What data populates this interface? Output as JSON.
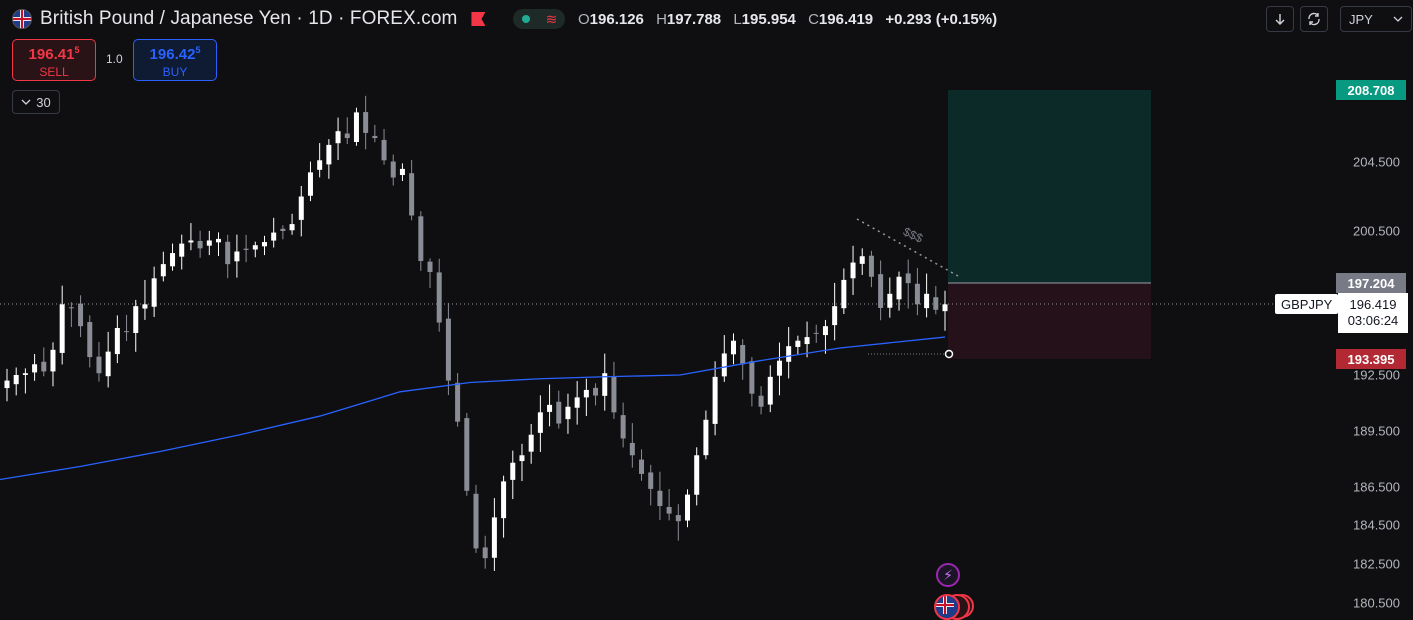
{
  "header": {
    "title": "British Pound / Japanese Yen · 1D · FOREX.com",
    "ohlc": {
      "open_label": "O",
      "open": "196.126",
      "high_label": "H",
      "high": "197.788",
      "low_label": "L",
      "low": "195.954",
      "close_label": "C",
      "close": "196.419",
      "change": "+0.293 (+0.15%)"
    }
  },
  "toolbar": {
    "currency": "JPY",
    "download_icon": "arrow-down-icon",
    "sync_icon": "sync-icon"
  },
  "trade": {
    "sell_price": "196.41",
    "sell_price_sup": "5",
    "sell_label": "SELL",
    "quantity": "1.0",
    "buy_price": "196.42",
    "buy_price_sup": "5",
    "buy_label": "BUY"
  },
  "indicator_toggle": {
    "label": "30"
  },
  "price_axis": {
    "labels": [
      "204.500",
      "200.500",
      "192.500",
      "189.500",
      "186.500",
      "184.500",
      "182.500",
      "180.500"
    ]
  },
  "position_tool": {
    "take_profit": "208.708",
    "entry": "197.204",
    "stop_loss": "193.395"
  },
  "current_price": {
    "symbol": "GBPJPY",
    "price": "196.419",
    "countdown": "03:06:24"
  },
  "annotation": "$$$",
  "colors": {
    "background": "#0f0f11",
    "candle_up": "#ffffff",
    "candle_down": "#8a8d96",
    "ma_line": "#2962ff",
    "tp_zone": "#0c2a27",
    "sl_zone": "#24111a",
    "sell": "#f23645",
    "buy": "#2962ff"
  },
  "chart_data": {
    "type": "candlestick",
    "symbol": "GBPJPY",
    "interval": "1D",
    "source": "FOREX.com",
    "ylim": [
      180.0,
      210.0
    ],
    "y_scale": "log-like (TradingView auto)",
    "ma_approx": [
      [
        0,
        186.9
      ],
      [
        80,
        187.6
      ],
      [
        160,
        188.4
      ],
      [
        240,
        189.3
      ],
      [
        320,
        190.3
      ],
      [
        400,
        191.6
      ],
      [
        470,
        192.1
      ],
      [
        540,
        192.3
      ],
      [
        600,
        192.4
      ],
      [
        680,
        192.5
      ],
      [
        760,
        193.3
      ],
      [
        840,
        194.0
      ],
      [
        945,
        194.6
      ]
    ],
    "closes_approx": [
      192.2,
      192.5,
      192.6,
      193.1,
      192.7,
      193.9,
      196.4,
      196.2,
      195.2,
      193.5,
      192.6,
      193.8,
      195.1,
      194.9,
      196.3,
      196.4,
      197.5,
      198.4,
      199.1,
      199.7,
      199.9,
      199.4,
      199.9,
      200.0,
      198.4,
      199.2,
      199.3,
      199.6,
      199.8,
      200.4,
      200.5,
      200.9,
      202.5,
      203.9,
      204.6,
      205.5,
      206.3,
      205.9,
      207.4,
      206.2,
      205.9,
      204.6,
      203.6,
      204.1,
      201.4,
      198.6,
      197.9,
      195.4,
      192.2,
      190.0,
      186.3,
      183.3,
      182.8,
      184.9,
      186.8,
      187.8,
      188.2,
      189.3,
      190.5,
      190.9,
      189.9,
      190.8,
      191.3,
      191.7,
      191.4,
      192.6,
      190.5,
      189.1,
      188.2,
      187.2,
      186.4,
      185.5,
      185.1,
      184.7,
      186.1,
      188.2,
      190.1,
      192.4,
      193.7,
      194.4,
      193.1,
      191.5,
      190.8,
      192.4,
      193.3,
      194.1,
      194.4,
      194.6,
      194.8,
      195.2,
      196.3,
      197.4,
      198.5,
      198.9,
      197.6,
      196.2,
      196.8,
      197.6,
      197.2,
      196.4,
      196.8,
      196.1,
      196.4
    ]
  }
}
